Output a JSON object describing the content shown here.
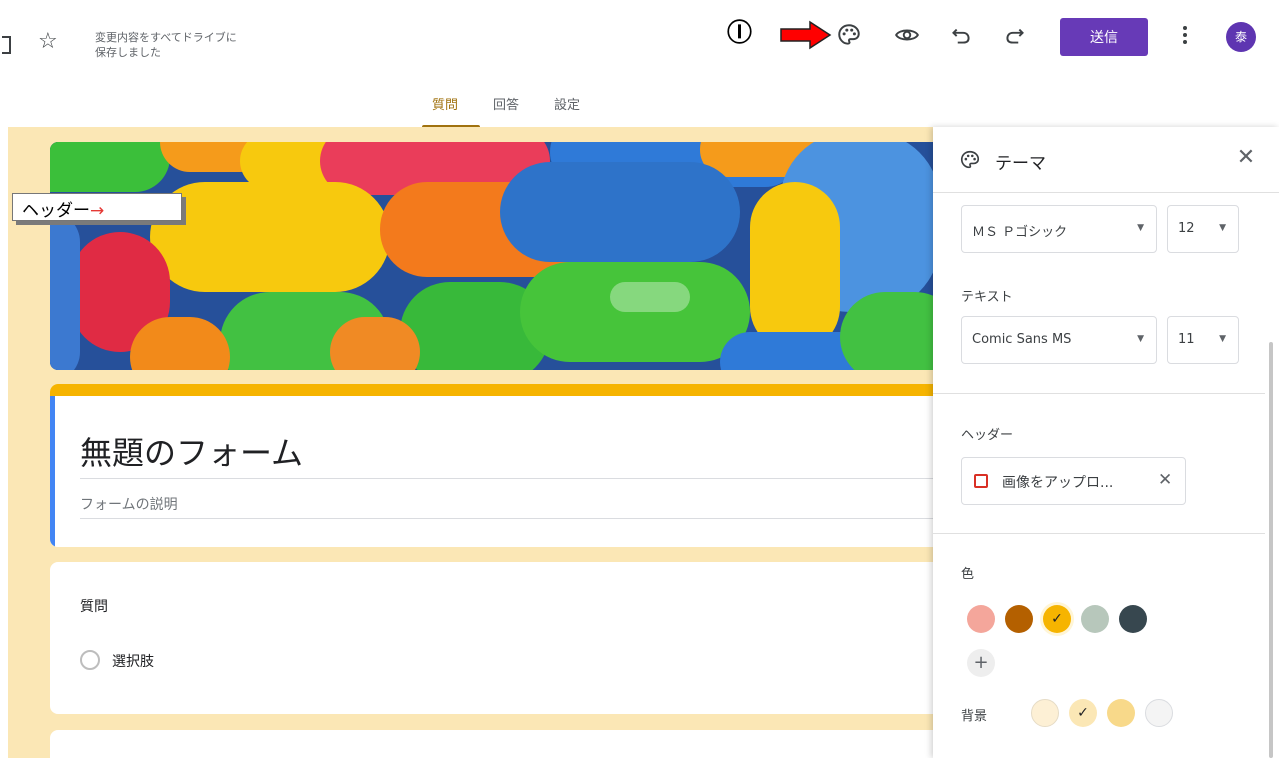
{
  "topbar": {
    "save_status": "変更内容をすべてドライブに\n保存しました",
    "annotation_number": "Ⓘ",
    "send_label": "送信",
    "avatar_initial": "泰"
  },
  "tabs": [
    {
      "label": "質問",
      "active": true
    },
    {
      "label": "回答",
      "active": false
    },
    {
      "label": "設定",
      "active": false
    }
  ],
  "header_callout": {
    "label": "ヘッダー",
    "arrow": "→"
  },
  "form": {
    "title": "無題のフォーム",
    "description_placeholder": "フォームの説明",
    "question": {
      "title": "質問",
      "option": "選択肢"
    }
  },
  "theme_panel": {
    "title": "テーマ",
    "header_font": {
      "family": "ＭＳ Ｐゴシック",
      "size": "12"
    },
    "text_section_label": "テキスト",
    "text_font": {
      "family": "Comic Sans MS",
      "size": "11"
    },
    "header_section_label": "ヘッダー",
    "upload_label": "画像をアップロ...",
    "color_section_label": "色",
    "colors": [
      {
        "hex": "#f4a69b",
        "selected": false
      },
      {
        "hex": "#b46000",
        "selected": false
      },
      {
        "hex": "#f6b400",
        "selected": true
      },
      {
        "hex": "#b7c7bb",
        "selected": false
      },
      {
        "hex": "#37474f",
        "selected": false
      }
    ],
    "background_label": "背景",
    "backgrounds": [
      {
        "hex": "#fdf0d5",
        "selected": false
      },
      {
        "hex": "#fbe7b5",
        "selected": true
      },
      {
        "hex": "#f8d98a",
        "selected": false
      },
      {
        "hex": "#f4f4f4",
        "selected": false
      }
    ]
  },
  "colors": {
    "accent": "#673ab7",
    "theme_amber": "#f6b400",
    "form_background": "#fbe7b5",
    "tab_active": "#a0720f"
  }
}
